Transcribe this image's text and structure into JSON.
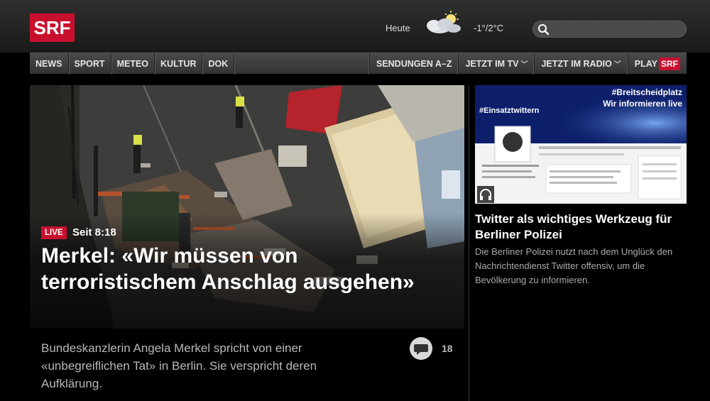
{
  "brand": {
    "logo_text": "SRF",
    "accent": "#c8102e"
  },
  "weather": {
    "label": "Heute",
    "icon": "partly-cloudy-icon",
    "temp": "-1°/2°C"
  },
  "search": {
    "placeholder": "",
    "icon": "search-icon"
  },
  "nav": {
    "left": [
      "NEWS",
      "SPORT",
      "METEO",
      "KULTUR",
      "DOK"
    ],
    "right": [
      {
        "label": "SENDUNGEN A–Z",
        "dropdown": false
      },
      {
        "label": "JETZT IM TV",
        "dropdown": true
      },
      {
        "label": "JETZT IM RADIO",
        "dropdown": true
      }
    ],
    "play": {
      "label": "PLAY",
      "badge": "SRF"
    }
  },
  "hero": {
    "live": "LIVE",
    "since": "Seit 8:18",
    "title": "Merkel: «Wir müssen von terroristischem Anschlag ausgehen»",
    "lead": "Bundeskanzlerin Angela Merkel spricht von einer «unbegreiflichen Tat» in Berlin. Sie verspricht deren Aufklärung.",
    "comments": "18"
  },
  "side": {
    "tags": [
      "#Breitscheidplatz",
      "Wir informieren live",
      "#Einsatztwittern"
    ],
    "title": "Twitter als wichtiges Werkzeug für Berliner Polizei",
    "text": "Die Berliner Polizei nutzt nach dem Unglück den Nachrichtendienst Twitter offensiv, um die Bevölkerung zu informieren."
  }
}
